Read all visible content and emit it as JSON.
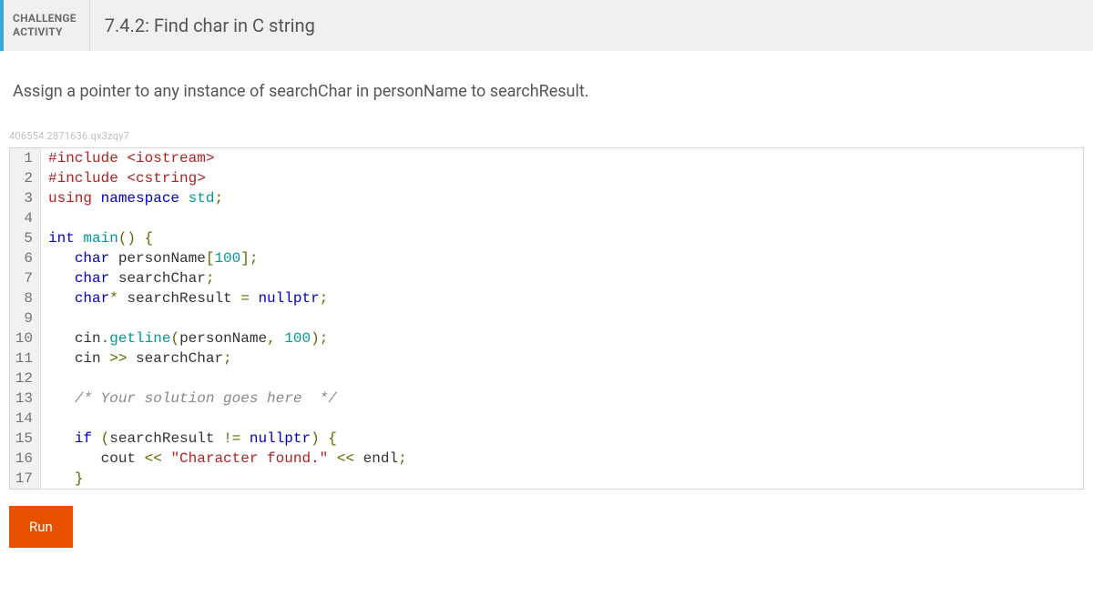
{
  "header": {
    "badge_line1": "CHALLENGE",
    "badge_line2": "ACTIVITY",
    "title": "7.4.2: Find char in C string"
  },
  "instructions": "Assign a pointer to any instance of searchChar in personName to searchResult.",
  "hash": "406554.2871636.qx3zqy7",
  "code_lines": [
    {
      "n": "1",
      "tokens": [
        [
          "tok-pre",
          "#include "
        ],
        [
          "tok-pre",
          "<iostream>"
        ]
      ]
    },
    {
      "n": "2",
      "tokens": [
        [
          "tok-pre",
          "#include "
        ],
        [
          "tok-pre",
          "<cstring>"
        ]
      ]
    },
    {
      "n": "3",
      "tokens": [
        [
          "tok-pre",
          "using "
        ],
        [
          "tok-kw",
          "namespace "
        ],
        [
          "tok-type",
          "std"
        ],
        [
          "tok-punct",
          ";"
        ]
      ]
    },
    {
      "n": "4",
      "tokens": [
        [
          "",
          ""
        ]
      ]
    },
    {
      "n": "5",
      "tokens": [
        [
          "tok-kw",
          "int "
        ],
        [
          "tok-call",
          "main"
        ],
        [
          "tok-punct",
          "()"
        ],
        [
          "tok-id",
          " "
        ],
        [
          "tok-brace",
          "{"
        ]
      ]
    },
    {
      "n": "6",
      "tokens": [
        [
          "",
          "   "
        ],
        [
          "tok-kw",
          "char "
        ],
        [
          "tok-id",
          "personName"
        ],
        [
          "tok-punct",
          "["
        ],
        [
          "tok-num",
          "100"
        ],
        [
          "tok-punct",
          "];"
        ]
      ]
    },
    {
      "n": "7",
      "tokens": [
        [
          "",
          "   "
        ],
        [
          "tok-kw",
          "char "
        ],
        [
          "tok-id",
          "searchChar"
        ],
        [
          "tok-punct",
          ";"
        ]
      ]
    },
    {
      "n": "8",
      "tokens": [
        [
          "",
          "   "
        ],
        [
          "tok-kw",
          "char"
        ],
        [
          "tok-op",
          "* "
        ],
        [
          "tok-id",
          "searchResult "
        ],
        [
          "tok-op",
          "= "
        ],
        [
          "tok-kw",
          "nullptr"
        ],
        [
          "tok-punct",
          ";"
        ]
      ]
    },
    {
      "n": "9",
      "tokens": [
        [
          "",
          ""
        ]
      ]
    },
    {
      "n": "10",
      "tokens": [
        [
          "",
          "   "
        ],
        [
          "tok-id",
          "cin"
        ],
        [
          "tok-punct",
          "."
        ],
        [
          "tok-call",
          "getline"
        ],
        [
          "tok-punct",
          "("
        ],
        [
          "tok-id",
          "personName"
        ],
        [
          "tok-punct",
          ", "
        ],
        [
          "tok-num",
          "100"
        ],
        [
          "tok-punct",
          ");"
        ]
      ]
    },
    {
      "n": "11",
      "tokens": [
        [
          "",
          "   "
        ],
        [
          "tok-id",
          "cin "
        ],
        [
          "tok-op",
          ">> "
        ],
        [
          "tok-id",
          "searchChar"
        ],
        [
          "tok-punct",
          ";"
        ]
      ]
    },
    {
      "n": "12",
      "tokens": [
        [
          "",
          ""
        ]
      ]
    },
    {
      "n": "13",
      "tokens": [
        [
          "",
          "   "
        ],
        [
          "tok-cmt",
          "/* Your solution goes here  */"
        ]
      ]
    },
    {
      "n": "14",
      "tokens": [
        [
          "",
          ""
        ]
      ]
    },
    {
      "n": "15",
      "tokens": [
        [
          "",
          "   "
        ],
        [
          "tok-kw",
          "if "
        ],
        [
          "tok-punct",
          "("
        ],
        [
          "tok-id",
          "searchResult "
        ],
        [
          "tok-op",
          "!= "
        ],
        [
          "tok-kw",
          "nullptr"
        ],
        [
          "tok-punct",
          ") "
        ],
        [
          "tok-brace",
          "{"
        ]
      ]
    },
    {
      "n": "16",
      "tokens": [
        [
          "",
          "      "
        ],
        [
          "tok-id",
          "cout "
        ],
        [
          "tok-op",
          "<< "
        ],
        [
          "tok-str",
          "\"Character found.\""
        ],
        [
          "tok-op",
          " << "
        ],
        [
          "tok-id",
          "endl"
        ],
        [
          "tok-punct",
          ";"
        ]
      ]
    },
    {
      "n": "17",
      "tokens": [
        [
          "",
          "   "
        ],
        [
          "tok-brace",
          "}"
        ]
      ]
    }
  ],
  "run_label": "Run"
}
